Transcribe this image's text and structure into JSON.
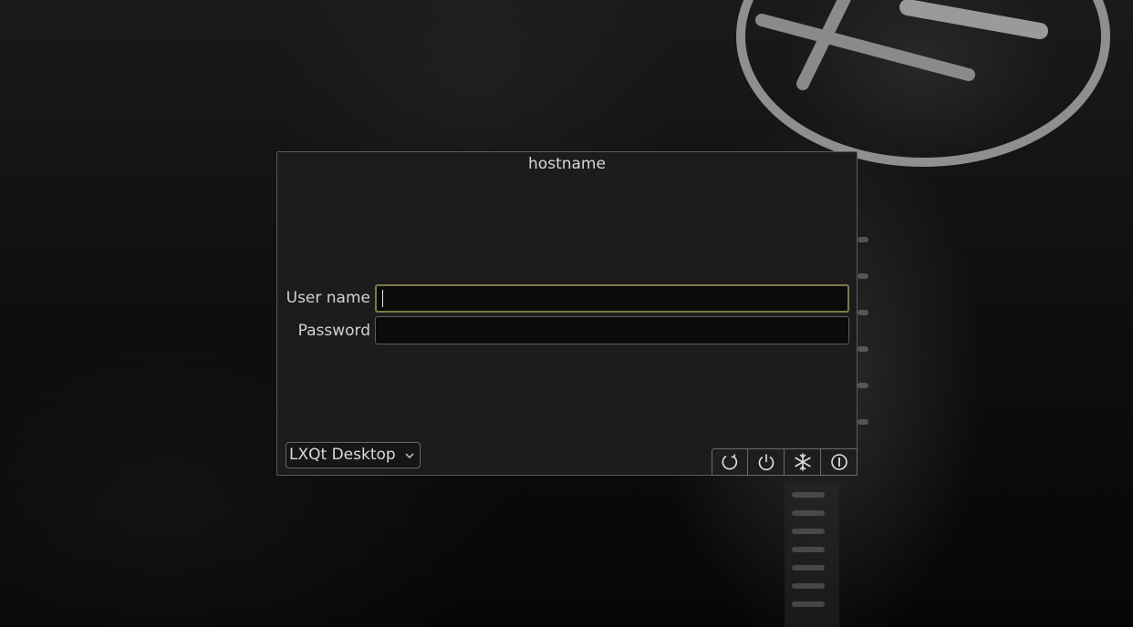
{
  "hostname": "hostname",
  "fields": {
    "username_label": "User name",
    "username_value": "",
    "password_label": "Password",
    "password_value": ""
  },
  "session": {
    "selected": "LXQt Desktop"
  },
  "power_buttons": [
    {
      "name": "reboot",
      "icon": "reboot-icon"
    },
    {
      "name": "shutdown",
      "icon": "power-icon"
    },
    {
      "name": "suspend",
      "icon": "snowflake-icon"
    },
    {
      "name": "hibernate",
      "icon": "hibernate-icon"
    }
  ],
  "colors": {
    "focus_border": "#7d7a46",
    "panel_bg": "#1c1c1c",
    "text": "#d6d6d6"
  }
}
